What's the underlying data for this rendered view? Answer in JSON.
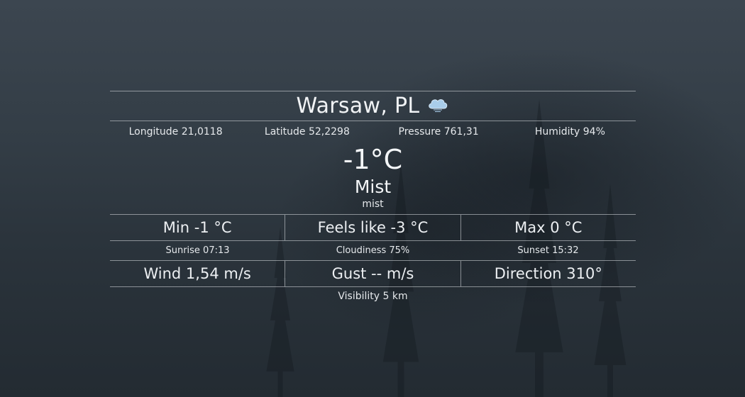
{
  "location": {
    "city_label": "Warsaw, PL",
    "weather_icon": "cloud-icon"
  },
  "coords": {
    "longitude": "Longitude 21,0118",
    "latitude": "Latitude 52,2298",
    "pressure": "Pressure 761,31",
    "humidity": "Humidity 94%"
  },
  "current": {
    "temperature": "-1°C",
    "condition": "Mist",
    "description": "mist"
  },
  "temps": {
    "min": "Min -1 °C",
    "feels_like": "Feels like -3 °C",
    "max": "Max 0 °C"
  },
  "sky": {
    "sunrise": "Sunrise 07:13",
    "cloudiness": "Cloudiness 75%",
    "sunset": "Sunset 15:32"
  },
  "wind": {
    "speed": "Wind 1,54 m/s",
    "gust": "Gust -- m/s",
    "direction": "Direction 310°"
  },
  "visibility": "Visibility 5 km",
  "colors": {
    "background": "#333d46",
    "text": "#e6e9ec",
    "icon_cloud": "#a9cdea"
  }
}
